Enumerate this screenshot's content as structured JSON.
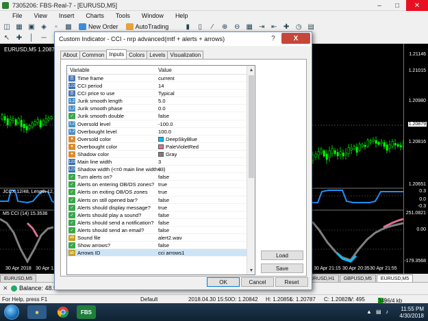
{
  "window": {
    "title": "7305206: FBS-Real-7 - [EURUSD,M5]"
  },
  "menu": [
    "File",
    "View",
    "Insert",
    "Charts",
    "Tools",
    "Window",
    "Help"
  ],
  "toolbar": {
    "new_order": "New Order",
    "autotrading": "AutoTrading"
  },
  "chart": {
    "symbol_label": "EURUSD,M5  1.20873 1.20...",
    "jccx_label": "JCCX 12/48, Length 12, 3/c...",
    "cci_label": "M5 CCI (14) 15.3536",
    "prices": [
      "1.21146",
      "1.21015",
      "1.20980",
      "1.20879",
      "1.20816",
      "1.20651",
      "1.20546"
    ],
    "current_price": "1.20879",
    "jccx_scale": [
      "0.3",
      "0.0",
      "-0.3"
    ],
    "cci_scale": [
      "251.0821",
      "0.00",
      "-179.3568"
    ],
    "times": [
      "30 Apr 2018",
      "30 Apr 12:35",
      "30 Apr 21:15",
      "30 Apr 20:35",
      "30 Apr 21:15",
      "30 Apr 21:55"
    ]
  },
  "chart_tabs": [
    "EURUSD,M5",
    "EURUSD,H1",
    "GBPUSD,M5",
    "EURUSD,M5"
  ],
  "terminal": {
    "balance": "Balance: 48.50 USD"
  },
  "status": {
    "help": "For Help, press F1",
    "profile": "Default",
    "datetime": "2018.04.30 15:50",
    "open": "O: 1.20842",
    "high": "H: 1.20856",
    "low": "L: 1.20787",
    "close": "C: 1.20828",
    "volume": "V: 495",
    "traffic": "3496/4 kb"
  },
  "taskbar": {
    "time": "11:55 PM",
    "date": "4/30/2018",
    "fbs": "FBS"
  },
  "dialog": {
    "title": "Custom Indicator - CCI - nrp  advanced(mtf + alerts + arrows)",
    "help_btn": "?",
    "close_btn": "X",
    "tabs": [
      "About",
      "Common",
      "Inputs",
      "Colors",
      "Levels",
      "Visualization"
    ],
    "active_tab": "Inputs",
    "columns": {
      "variable": "Variable",
      "value": "Value"
    },
    "params": [
      {
        "name": "Time frame",
        "value": "current",
        "icon": "enum"
      },
      {
        "name": "CCI period",
        "value": "14",
        "icon": "int"
      },
      {
        "name": "CCI price to use",
        "value": "Typical",
        "icon": "enum"
      },
      {
        "name": "Jurik smooth length",
        "value": "5.0",
        "icon": "double"
      },
      {
        "name": "Jurik smooth phase",
        "value": "0.0",
        "icon": "double"
      },
      {
        "name": "Jurik smooth double",
        "value": "false",
        "icon": "bool"
      },
      {
        "name": "Oversold level",
        "value": "-100.0",
        "icon": "double"
      },
      {
        "name": "Overbought level",
        "value": "100.0",
        "icon": "double"
      },
      {
        "name": "Oversold color",
        "value": "DeepSkyBlue",
        "icon": "color",
        "swatch": "#00bfff"
      },
      {
        "name": "Overbought color",
        "value": "PaleVioletRed",
        "icon": "color",
        "swatch": "#db7093"
      },
      {
        "name": "Shadow color",
        "value": "Gray",
        "icon": "color",
        "swatch": "#808080"
      },
      {
        "name": "Main line width",
        "value": "3",
        "icon": "int"
      },
      {
        "name": "Shadow width (<=0 main line width+3)",
        "value": "0",
        "icon": "int"
      },
      {
        "name": "Turn alerts on?",
        "value": "false",
        "icon": "bool"
      },
      {
        "name": "Alerts on entering OB/OS zones?",
        "value": "true",
        "icon": "bool"
      },
      {
        "name": "Alerts on exiting OB/OS zones",
        "value": "true",
        "icon": "bool"
      },
      {
        "name": "Alerts on still opened bar?",
        "value": "false",
        "icon": "bool"
      },
      {
        "name": "Alerts should display message?",
        "value": "true",
        "icon": "bool"
      },
      {
        "name": "Alerts should play a sound?",
        "value": "false",
        "icon": "bool"
      },
      {
        "name": "Alerts should send a notification?",
        "value": "false",
        "icon": "bool"
      },
      {
        "name": "Alerts should send an email?",
        "value": "false",
        "icon": "bool"
      },
      {
        "name": "Sound file",
        "value": "alert2.wav",
        "icon": "string"
      },
      {
        "name": "Show arrows?",
        "value": "false",
        "icon": "bool"
      },
      {
        "name": "Arrows ID",
        "value": "cci arrows1",
        "icon": "string"
      }
    ],
    "selected_row": 23,
    "buttons": {
      "load": "Load",
      "save": "Save",
      "ok": "OK",
      "cancel": "Cancel",
      "reset": "Reset"
    }
  },
  "icon_colors": {
    "enum": "#4a76b8",
    "int": "#3a6fb0",
    "double": "#4a8fc8",
    "bool": "#3aa84a",
    "color": "#e08a2a",
    "string": "#c8a020"
  }
}
